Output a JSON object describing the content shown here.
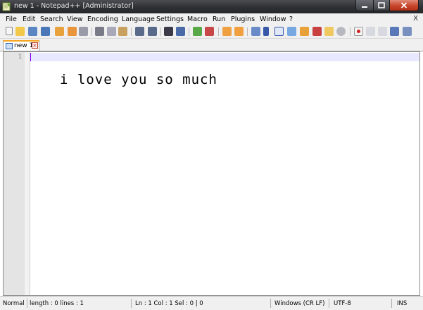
{
  "window": {
    "title": "new 1 - Notepad++ [Administrator]",
    "controls": [
      "minimize",
      "maximize",
      "close"
    ]
  },
  "menu": {
    "items": [
      "File",
      "Edit",
      "Search",
      "View",
      "Encoding",
      "Language",
      "Settings",
      "Macro",
      "Run",
      "Plugins",
      "Window",
      "?"
    ],
    "close_label": "X"
  },
  "toolbar": {
    "icons": [
      "new-file-icon",
      "open-file-icon",
      "save-icon",
      "save-all-icon",
      "close-icon",
      "close-all-icon",
      "print-icon",
      "cut-icon",
      "copy-icon",
      "paste-icon",
      "undo-icon",
      "redo-icon",
      "find-icon",
      "replace-icon",
      "zoom-in-icon",
      "zoom-out-icon",
      "sync-vertical-icon",
      "sync-horizontal-icon",
      "word-wrap-icon",
      "show-all-chars-icon",
      "indent-guide-icon",
      "user-lang-icon",
      "doc-map-icon",
      "function-list-icon",
      "folder-workspace-icon",
      "monitoring-icon",
      "record-macro-icon",
      "stop-record-icon",
      "play-macro-icon",
      "run-macro-multiple-icon",
      "save-macro-icon"
    ]
  },
  "tabs": [
    {
      "label": "new 1",
      "active": true
    }
  ],
  "editor": {
    "line_numbers": [
      "1"
    ],
    "content": "",
    "overlay_text": "i love you so much"
  },
  "status": {
    "type": "Normal",
    "length_lines": "length : 0    lines : 1",
    "position": "Ln : 1    Col : 1    Sel : 0 | 0",
    "eol": "Windows (CR LF)",
    "encoding": "UTF-8",
    "mode": "INS"
  },
  "colors": {
    "title_bar": "#2e3034",
    "close_button": "#c8452b",
    "active_tab_accent": "#f6a623",
    "current_line": "#e8e8ff",
    "caret": "#8000ff"
  }
}
